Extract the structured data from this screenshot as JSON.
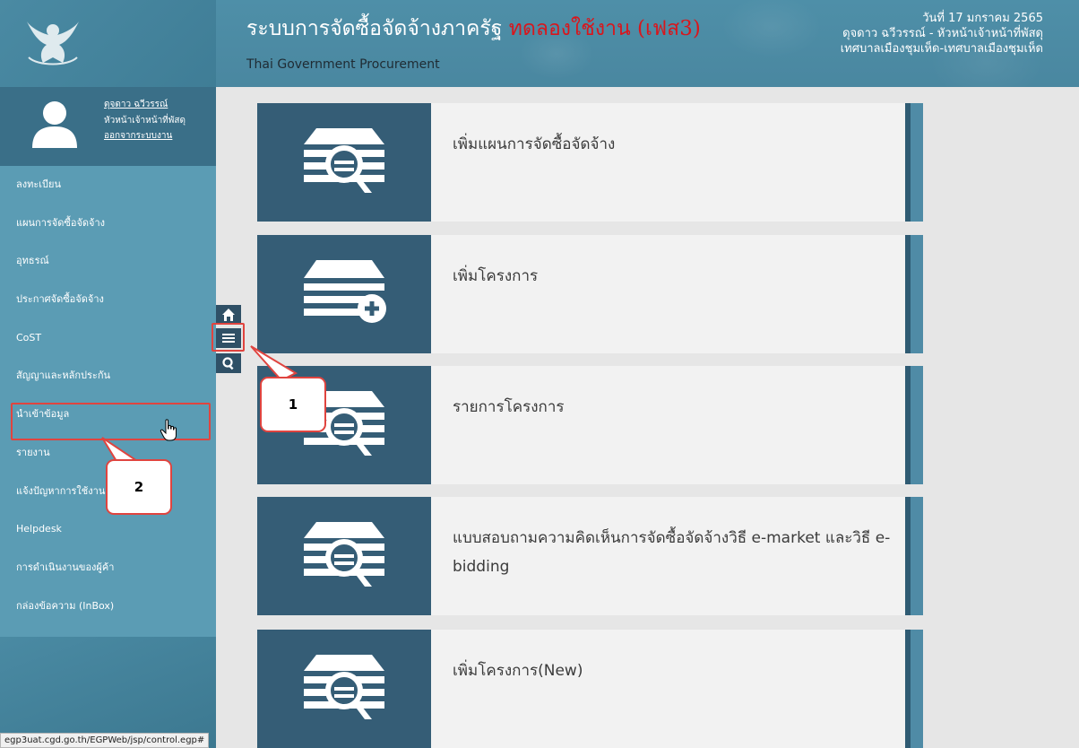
{
  "header": {
    "title_main": "ระบบการจัดซื้อจัดจ้างภาครัฐ",
    "title_beta": "ทดลองใช้งาน (เฟส3)",
    "subtitle": "Thai Government Procurement",
    "date": "วันที่ 17 มกราคม 2565",
    "user_role_line": "ดุจดาว ฉวีวรรณ์ - หัวหน้าเจ้าหน้าที่พัสดุ",
    "org": "เทศบาลเมืองชุมเห็ด-เทศบาลเมืองชุมเห็ด"
  },
  "profile": {
    "name": "ดุจดาว ฉวีวรรณ์",
    "role": "หัวหน้าเจ้าหน้าที่พัสดุ",
    "logout": "ออกจากระบบงาน"
  },
  "menu": {
    "items": [
      {
        "label": "ลงทะเบียน"
      },
      {
        "label": "แผนการจัดซื้อจัดจ้าง"
      },
      {
        "label": "อุทธรณ์"
      },
      {
        "label": "ประกาศจัดซื้อจัดจ้าง"
      },
      {
        "label": "CoST"
      },
      {
        "label": "สัญญาและหลักประกัน"
      },
      {
        "label": "นำเข้าข้อมูล"
      },
      {
        "label": "รายงาน"
      },
      {
        "label": "แจ้งปัญหาการใช้งาน"
      },
      {
        "label": "Helpdesk"
      },
      {
        "label": "การดำเนินงานของผู้ค้า"
      },
      {
        "label": "กล่องข้อความ (InBox)"
      }
    ]
  },
  "tools": [
    "home-icon",
    "menu-icon",
    "search-icon"
  ],
  "cards": [
    {
      "label": "เพิ่มแผนการจัดซื้อจัดจ้าง",
      "icon": "search-document-icon"
    },
    {
      "label": "เพิ่มโครงการ",
      "icon": "add-stack-icon"
    },
    {
      "label": "รายการโครงการ",
      "icon": "search-document-icon"
    },
    {
      "label": "แบบสอบถามความคิดเห็นการจัดซื้อจัดจ้างวิธี e-market และวิธี e-bidding",
      "icon": "search-document-icon"
    },
    {
      "label": "เพิ่มโครงการ(New)",
      "icon": "search-document-icon"
    }
  ],
  "annotations": {
    "callout_1": "1",
    "callout_2": "2"
  },
  "statusbar": {
    "url": "egp3uat.cgd.go.th/EGPWeb/jsp/control.egp#"
  },
  "colors": {
    "header_bg": "#4e8fa8",
    "sidebar_bg": "#5b9cb4",
    "profile_bg": "#3a6f88",
    "tile_bg": "#355d76",
    "beta_red": "#d9161c",
    "annotation_red": "#e0443f"
  }
}
